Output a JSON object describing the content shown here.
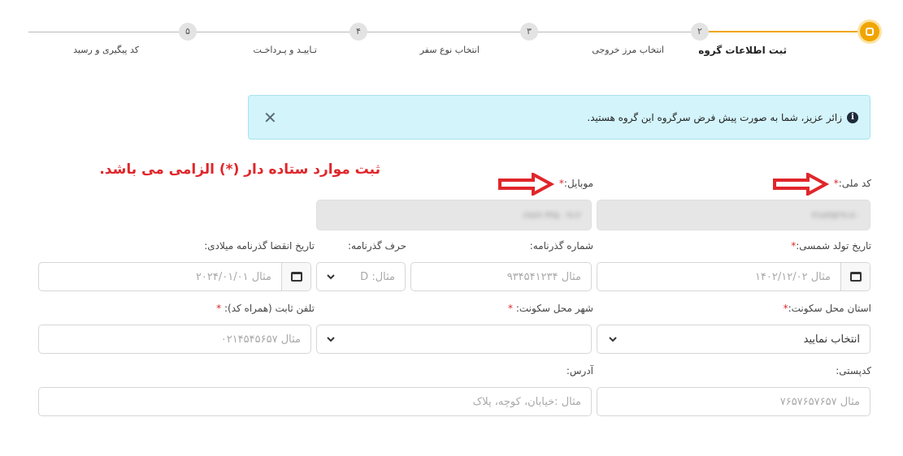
{
  "stepper": {
    "steps": [
      {
        "number": "",
        "label": "ثبت اطلاعات گروه",
        "active": true
      },
      {
        "number": "۲",
        "label": "انتخاب مرز خروجی",
        "active": false
      },
      {
        "number": "۳",
        "label": "انتخاب نوع سفر",
        "active": false
      },
      {
        "number": "۴",
        "label": "تـاییـد و پـرداخـت",
        "active": false
      },
      {
        "number": "۵",
        "label": "کد پیگیری و رسید",
        "active": false
      }
    ]
  },
  "alert": {
    "text": "زائر عزیز، شما به صورت پیش فرض سرگروه این گروه هستید.",
    "icon": "info-icon",
    "close_icon": "close-icon"
  },
  "required_note": "ثبت موارد ستاده دار (*) الزامی می باشد.",
  "form": {
    "national_code": {
      "label": "کد ملی:",
      "required_mark": "*",
      "value": "۴۶۸۳۵۲۹۱۷۰"
    },
    "mobile": {
      "label": "موبایل:",
      "required_mark": "*",
      "value": "۰۹۱۲ ۳۴۵ ۶۷۸۹"
    },
    "birth_date": {
      "label": "تاریخ تولد شمسی:",
      "required_mark": "*",
      "placeholder": "مثال ۱۴۰۲/۱۲/۰۲"
    },
    "passport_number": {
      "label": "شماره گذرنامه:",
      "placeholder": "مثال ۹۳۴۵۴۱۲۳۴"
    },
    "passport_letter": {
      "label": "حرف گذرنامه:",
      "placeholder": "مثال: D"
    },
    "passport_expiry": {
      "label": "تاریخ انقضا گذرنامه میلادی:",
      "placeholder": "مثال ۲۰۲۴/۰۱/۰۱"
    },
    "province": {
      "label": "استان محل سکونت:",
      "required_mark": "*",
      "value": "انتخاب نمایید"
    },
    "city": {
      "label": "شهر محل سکونت: ",
      "required_mark": "*",
      "value": ""
    },
    "phone": {
      "label": "تلفن ثابت (همراه کد): ",
      "required_mark": "*",
      "placeholder": "مثال ۰۲۱۴۵۴۵۶۵۷"
    },
    "postal_code": {
      "label": "کدپستی:",
      "placeholder": "مثال ۷۶۵۷۶۵۷۶۵۷"
    },
    "address": {
      "label": "آدرس:",
      "placeholder": "مثال :خیابان، کوچه، پلاک"
    }
  },
  "colors": {
    "accent": "#f0a500",
    "required": "#e0262b",
    "alert_bg": "#d3f4fb"
  }
}
